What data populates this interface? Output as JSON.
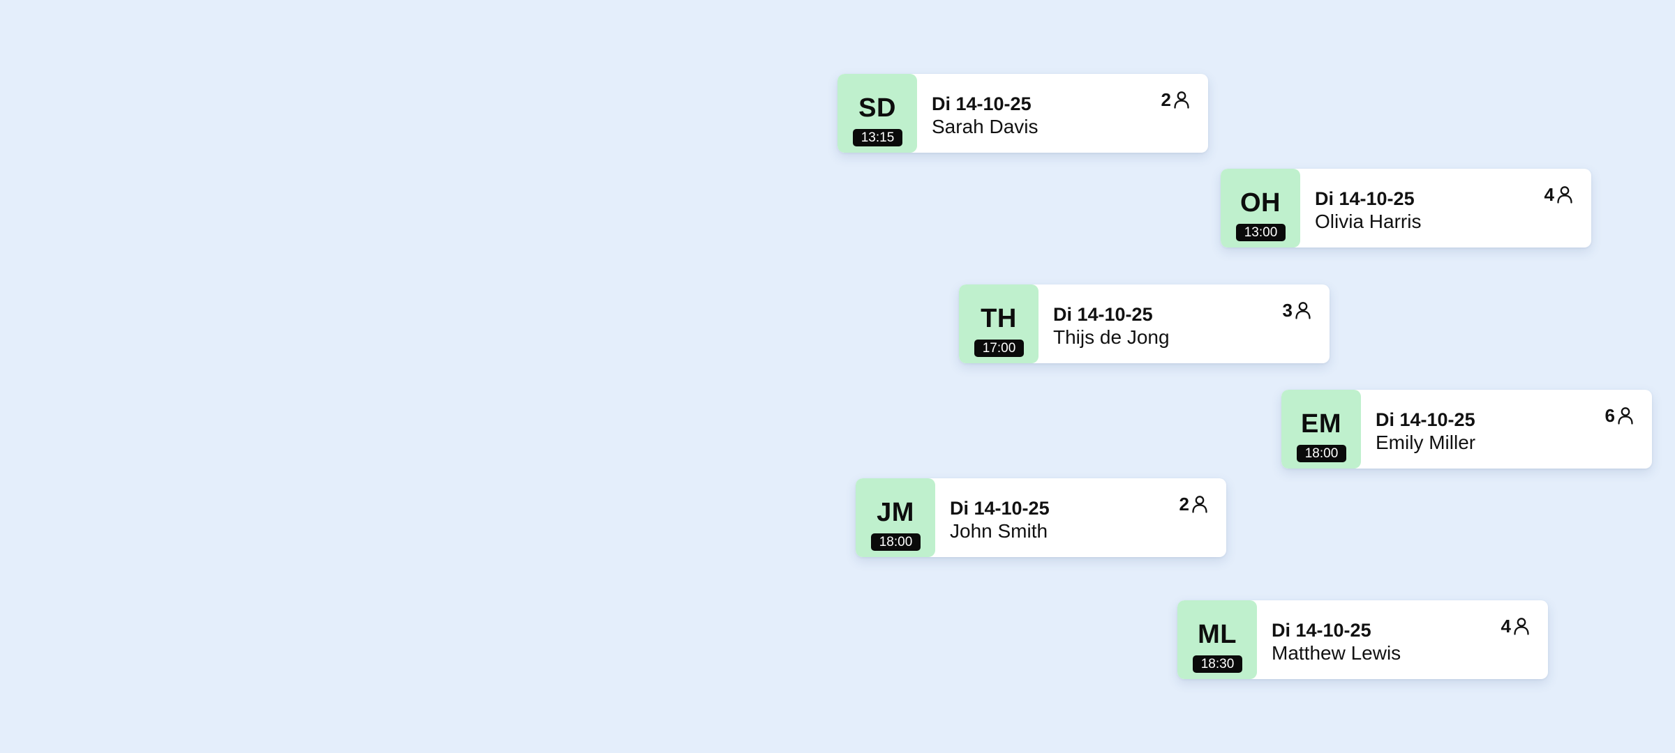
{
  "colors": {
    "background": "#e4eefb",
    "card": "#ffffff",
    "avatar": "#bff0cd",
    "time_badge": "#0a0a0a"
  },
  "reservations": [
    {
      "initials": "SD",
      "time": "13:15",
      "date": "Di 14-10-25",
      "name": "Sarah Davis",
      "guests": "2",
      "icon": "person-icon"
    },
    {
      "initials": "OH",
      "time": "13:00",
      "date": "Di 14-10-25",
      "name": "Olivia Harris",
      "guests": "4",
      "icon": "person-icon"
    },
    {
      "initials": "TH",
      "time": "17:00",
      "date": "Di 14-10-25",
      "name": "Thijs de Jong",
      "guests": "3",
      "icon": "person-icon"
    },
    {
      "initials": "EM",
      "time": "18:00",
      "date": "Di 14-10-25",
      "name": "Emily Miller",
      "guests": "6",
      "icon": "person-icon"
    },
    {
      "initials": "JM",
      "time": "18:00",
      "date": "Di 14-10-25",
      "name": "John Smith",
      "guests": "2",
      "icon": "person-icon"
    },
    {
      "initials": "ML",
      "time": "18:30",
      "date": "Di 14-10-25",
      "name": "Matthew Lewis",
      "guests": "4",
      "icon": "person-icon"
    }
  ]
}
